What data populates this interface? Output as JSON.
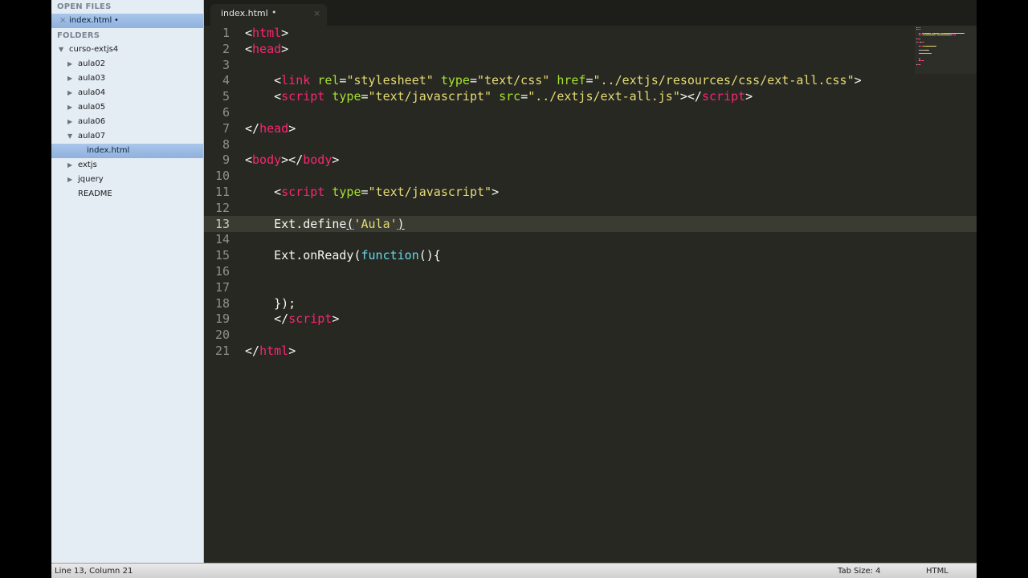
{
  "sidebar": {
    "open_files_header": "OPEN FILES",
    "open_file": {
      "name": "index.html",
      "dirty_mark": "•",
      "close": "×"
    },
    "folders_header": "FOLDERS",
    "tree": [
      {
        "label": "curso-extjs4",
        "expanded": true
      },
      {
        "label": "aula02"
      },
      {
        "label": "aula03"
      },
      {
        "label": "aula04"
      },
      {
        "label": "aula05"
      },
      {
        "label": "aula06"
      },
      {
        "label": "aula07",
        "expanded": true
      },
      {
        "label": "index.html",
        "selected": true
      },
      {
        "label": "extjs"
      },
      {
        "label": "jquery"
      },
      {
        "label": "README"
      }
    ]
  },
  "tab": {
    "title": "index.html",
    "dirty_mark": "•",
    "close": "×"
  },
  "editor": {
    "current_line": 13,
    "lines": [
      [
        [
          "<",
          "p"
        ],
        [
          "html",
          "tag"
        ],
        [
          ">",
          "p"
        ]
      ],
      [
        [
          "<",
          "p"
        ],
        [
          "head",
          "tag"
        ],
        [
          ">",
          "p"
        ]
      ],
      [],
      [
        [
          "    <",
          "p"
        ],
        [
          "link",
          "tag"
        ],
        [
          " ",
          "p"
        ],
        [
          "rel",
          "attr"
        ],
        [
          "=",
          "p"
        ],
        [
          "\"stylesheet\"",
          "str"
        ],
        [
          " ",
          "p"
        ],
        [
          "type",
          "attr"
        ],
        [
          "=",
          "p"
        ],
        [
          "\"text/css\"",
          "str"
        ],
        [
          " ",
          "p"
        ],
        [
          "href",
          "attr"
        ],
        [
          "=",
          "p"
        ],
        [
          "\"../extjs/resources/css/ext-all.css\"",
          "str"
        ],
        [
          ">",
          "p"
        ]
      ],
      [
        [
          "    <",
          "p"
        ],
        [
          "script",
          "tag"
        ],
        [
          " ",
          "p"
        ],
        [
          "type",
          "attr"
        ],
        [
          "=",
          "p"
        ],
        [
          "\"text/javascript\"",
          "str"
        ],
        [
          " ",
          "p"
        ],
        [
          "src",
          "attr"
        ],
        [
          "=",
          "p"
        ],
        [
          "\"../extjs/ext-all.js\"",
          "str"
        ],
        [
          "></",
          "p"
        ],
        [
          "script",
          "tag"
        ],
        [
          ">",
          "p"
        ]
      ],
      [],
      [
        [
          "</",
          "p"
        ],
        [
          "head",
          "tag"
        ],
        [
          ">",
          "p"
        ]
      ],
      [],
      [
        [
          "<",
          "p"
        ],
        [
          "body",
          "tag"
        ],
        [
          "></",
          "p"
        ],
        [
          "body",
          "tag"
        ],
        [
          ">",
          "p"
        ]
      ],
      [],
      [
        [
          "    <",
          "p"
        ],
        [
          "script",
          "tag"
        ],
        [
          " ",
          "p"
        ],
        [
          "type",
          "attr"
        ],
        [
          "=",
          "p"
        ],
        [
          "\"text/javascript\"",
          "str"
        ],
        [
          ">",
          "p"
        ]
      ],
      [],
      [
        [
          "    Ext.define",
          "p"
        ],
        [
          "(",
          "ul"
        ],
        [
          "'Aula'",
          "str"
        ],
        [
          ")",
          "ul"
        ]
      ],
      [],
      [
        [
          "    Ext.onReady(",
          "p"
        ],
        [
          "function",
          "kw"
        ],
        [
          "(){",
          "p"
        ]
      ],
      [],
      [],
      [
        [
          "    });",
          "p"
        ]
      ],
      [
        [
          "    </",
          "p"
        ],
        [
          "script",
          "tag"
        ],
        [
          ">",
          "p"
        ]
      ],
      [],
      [
        [
          "</",
          "p"
        ],
        [
          "html",
          "tag"
        ],
        [
          ">",
          "p"
        ]
      ]
    ]
  },
  "status": {
    "position": "Line 13, Column 21",
    "tab_size": "Tab Size: 4",
    "syntax": "HTML"
  },
  "colors": {
    "background": "#272822",
    "tag": "#f92672",
    "attribute": "#a6e22e",
    "string": "#e6db74",
    "keyword": "#66d9ef"
  }
}
